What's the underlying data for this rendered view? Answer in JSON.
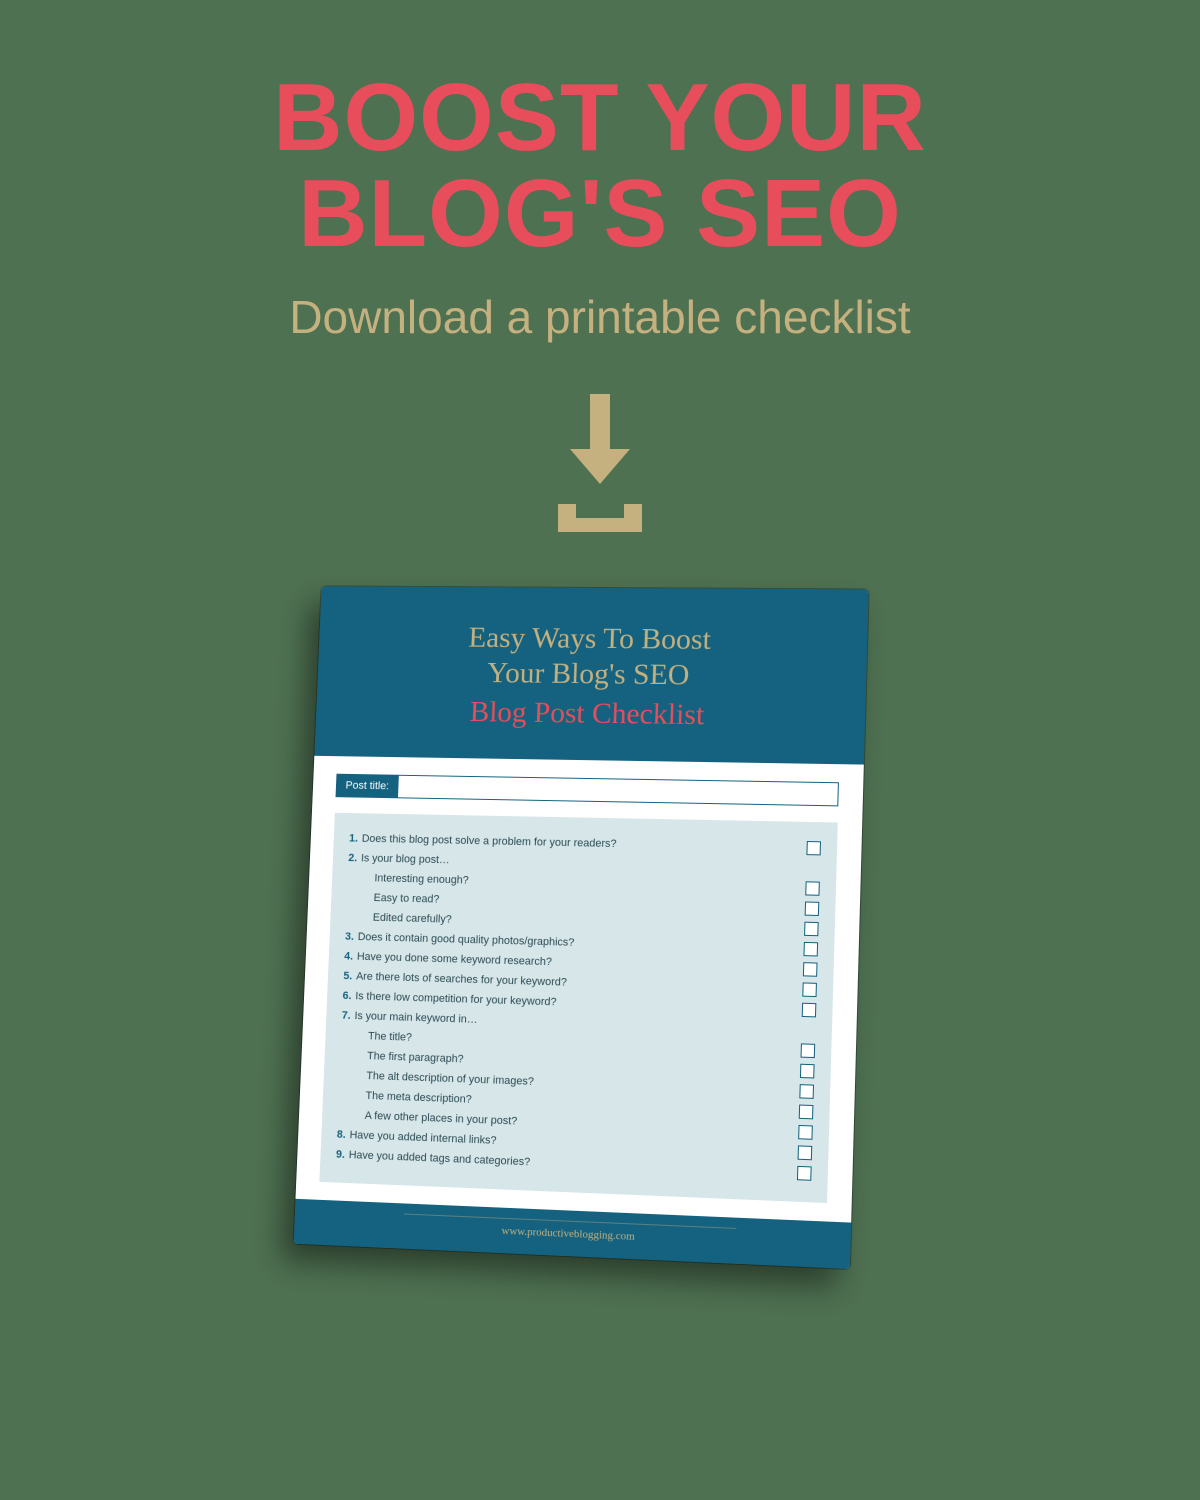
{
  "hero": {
    "title_line1": "BOOST YOUR",
    "title_line2": "BLOG'S SEO",
    "subtitle": "Download a printable checklist"
  },
  "mockup": {
    "header_line1a": "Easy Ways To Boost",
    "header_line1b": "Your Blog's SEO",
    "header_line2": "Blog Post Checklist",
    "post_title_label": "Post title:",
    "footer_url": "www.productiveblogging.com",
    "items": [
      {
        "num": "1.",
        "text": "Does this blog post solve a problem for your readers?",
        "box": true,
        "sub": false
      },
      {
        "num": "2.",
        "text": "Is your blog post…",
        "box": false,
        "sub": false
      },
      {
        "num": "",
        "text": "Interesting enough?",
        "box": true,
        "sub": true
      },
      {
        "num": "",
        "text": "Easy to read?",
        "box": true,
        "sub": true
      },
      {
        "num": "",
        "text": "Edited carefully?",
        "box": true,
        "sub": true
      },
      {
        "num": "3.",
        "text": "Does it contain good quality photos/graphics?",
        "box": true,
        "sub": false
      },
      {
        "num": "4.",
        "text": "Have you done some keyword research?",
        "box": true,
        "sub": false
      },
      {
        "num": "5.",
        "text": "Are there lots of searches for your keyword?",
        "box": true,
        "sub": false
      },
      {
        "num": "6.",
        "text": "Is there low competition for your keyword?",
        "box": true,
        "sub": false
      },
      {
        "num": "7.",
        "text": "Is your main keyword in…",
        "box": false,
        "sub": false
      },
      {
        "num": "",
        "text": "The title?",
        "box": true,
        "sub": true
      },
      {
        "num": "",
        "text": "The first paragraph?",
        "box": true,
        "sub": true
      },
      {
        "num": "",
        "text": "The alt description of your images?",
        "box": true,
        "sub": true
      },
      {
        "num": "",
        "text": "The meta description?",
        "box": true,
        "sub": true
      },
      {
        "num": "",
        "text": "A few other places in your post?",
        "box": true,
        "sub": true
      },
      {
        "num": "8.",
        "text": "Have you added internal links?",
        "box": true,
        "sub": false
      },
      {
        "num": "9.",
        "text": "Have you added tags and categories?",
        "box": true,
        "sub": false
      }
    ]
  },
  "colors": {
    "bg": "#4e7151",
    "accent_red": "#e84d5b",
    "accent_tan": "#c5b07f",
    "teal": "#14627f"
  }
}
